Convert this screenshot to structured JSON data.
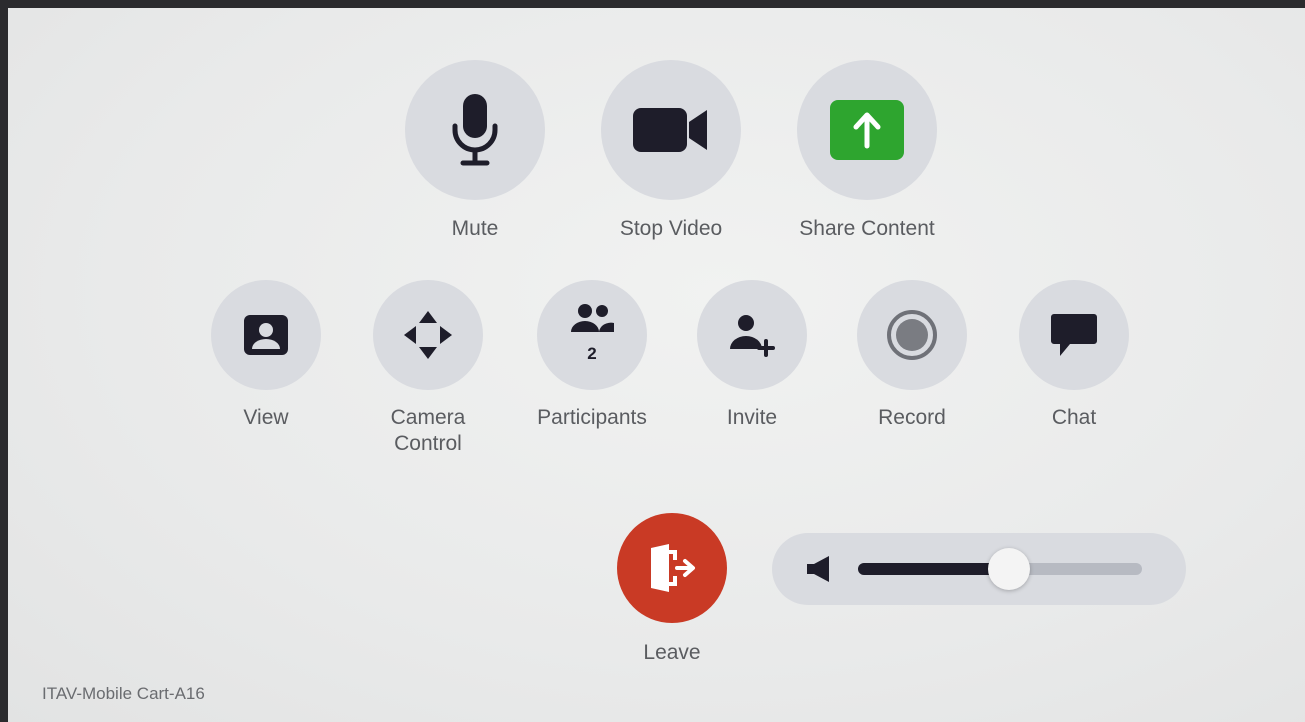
{
  "device_name": "ITAV-Mobile Cart-A16",
  "primary_controls": [
    {
      "id": "mute",
      "label": "Mute",
      "icon": "microphone-icon"
    },
    {
      "id": "stop-video",
      "label": "Stop Video",
      "icon": "video-camera-icon"
    },
    {
      "id": "share-content",
      "label": "Share Content",
      "icon": "share-upload-icon"
    }
  ],
  "secondary_controls": [
    {
      "id": "view",
      "label": "View",
      "icon": "view-layout-icon"
    },
    {
      "id": "camera-control",
      "label": "Camera Control",
      "icon": "directional-arrows-icon"
    },
    {
      "id": "participants",
      "label": "Participants",
      "icon": "participants-icon",
      "count": "2"
    },
    {
      "id": "invite",
      "label": "Invite",
      "icon": "add-person-icon"
    },
    {
      "id": "record",
      "label": "Record",
      "icon": "record-icon"
    },
    {
      "id": "chat",
      "label": "Chat",
      "icon": "chat-bubble-icon"
    }
  ],
  "leave": {
    "label": "Leave",
    "icon": "exit-door-icon"
  },
  "volume": {
    "level": 0.53,
    "icon": "speaker-icon"
  },
  "colors": {
    "button_background": "#d9dbe0",
    "icon_dark": "#1e1d2a",
    "share_accent": "#2ea52f",
    "leave_red": "#c93a25",
    "label_text": "#5a5c60"
  }
}
